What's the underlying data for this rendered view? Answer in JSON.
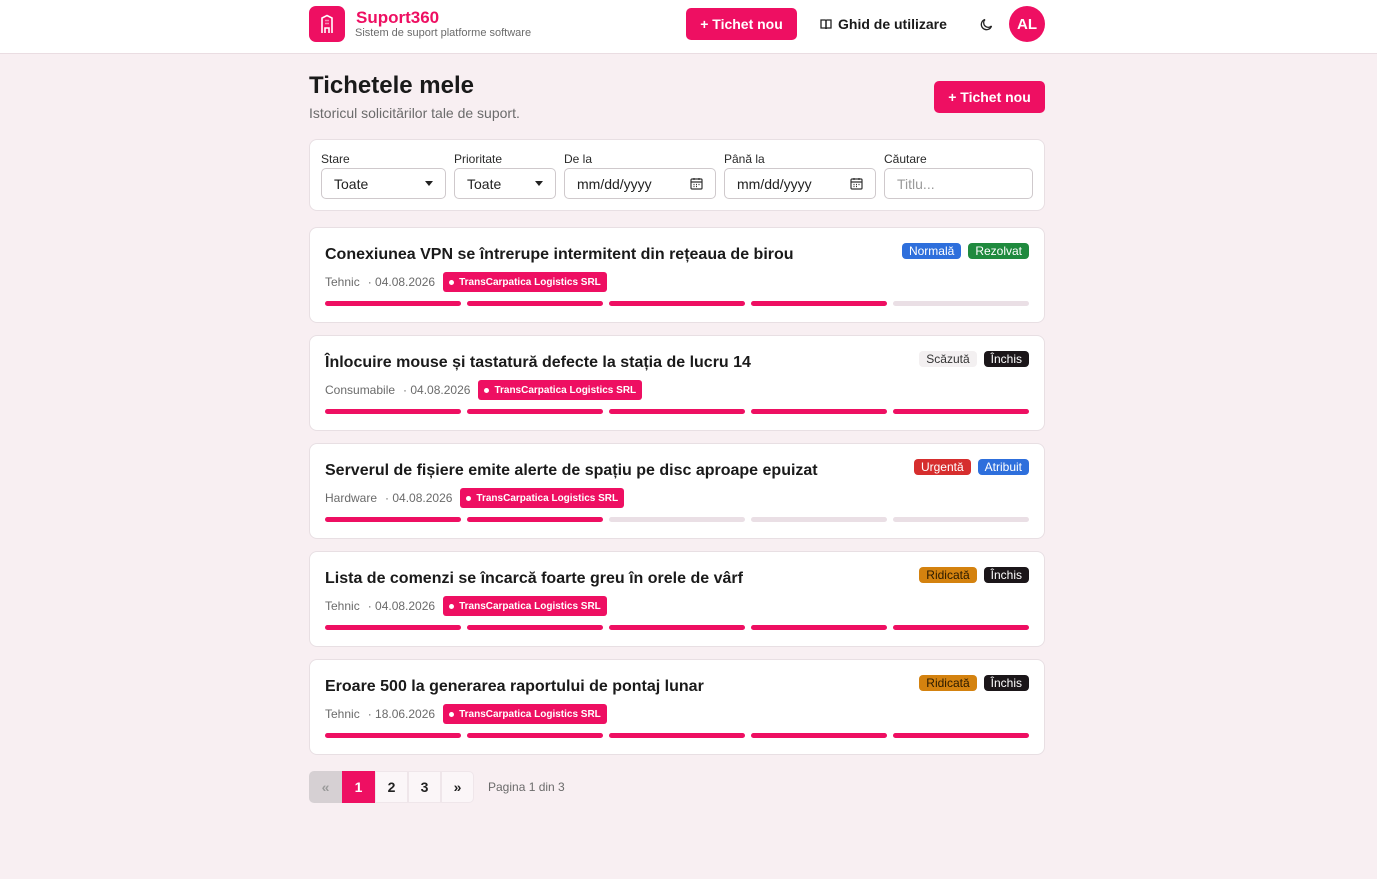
{
  "header": {
    "brand_name": "Suport360",
    "brand_sub": "Sistem de suport platforme software",
    "new_ticket": "+ Tichet nou",
    "guide": "Ghid de utilizare",
    "avatar": "AL"
  },
  "page": {
    "title": "Tichetele mele",
    "subtitle": "Istoricul solicitărilor tale de suport.",
    "new_ticket": "+ Tichet nou"
  },
  "filters": {
    "status_label": "Stare",
    "status_value": "Toate",
    "priority_label": "Prioritate",
    "priority_value": "Toate",
    "from_label": "De la",
    "from_placeholder": "mm/dd/yyyy",
    "to_label": "Până la",
    "to_placeholder": "mm/dd/yyyy",
    "search_label": "Căutare",
    "search_placeholder": "Titlu..."
  },
  "tickets": [
    {
      "title": "Conexiunea VPN se întrerupe intermitent din rețeaua de birou",
      "category": "Tehnic",
      "date": "· 04.08.2026",
      "company": "TransCarpatica Logistics SRL",
      "priority": "Normală",
      "priority_color": "#2e6fdc",
      "status": "Rezolvat",
      "status_color": "#1f8a3e",
      "progress_steps": 4
    },
    {
      "title": "Înlocuire mouse și tastatură defecte la stația de lucru 14",
      "category": "Consumabile",
      "date": "· 04.08.2026",
      "company": "TransCarpatica Logistics SRL",
      "priority": "Scăzută",
      "priority_color": "#f3f0f1",
      "status": "Închis",
      "status_color": "#1b1619",
      "progress_steps": 5
    },
    {
      "title": "Serverul de fișiere emite alerte de spațiu pe disc aproape epuizat",
      "category": "Hardware",
      "date": "· 04.08.2026",
      "company": "TransCarpatica Logistics SRL",
      "priority": "Urgentă",
      "priority_color": "#d62e2e",
      "status": "Atribuit",
      "status_color": "#2e6fdc",
      "progress_steps": 2
    },
    {
      "title": "Lista de comenzi se încarcă foarte greu în orele de vârf",
      "category": "Tehnic",
      "date": "· 04.08.2026",
      "company": "TransCarpatica Logistics SRL",
      "priority": "Ridicată",
      "priority_color": "#d4820f",
      "status": "Închis",
      "status_color": "#1b1619",
      "progress_steps": 5
    },
    {
      "title": "Eroare 500 la generarea raportului de pontaj lunar",
      "category": "Tehnic",
      "date": "· 18.06.2026",
      "company": "TransCarpatica Logistics SRL",
      "priority": "Ridicată",
      "priority_color": "#d4820f",
      "status": "Închis",
      "status_color": "#1b1619",
      "progress_steps": 5
    }
  ],
  "pagination": {
    "prev": "«",
    "pages": [
      "1",
      "2",
      "3"
    ],
    "next": "»",
    "current_page": 1,
    "info": "Pagina 1 din 3"
  },
  "colors": {
    "accent": "#ee0f62",
    "background": "#f8eff2"
  }
}
